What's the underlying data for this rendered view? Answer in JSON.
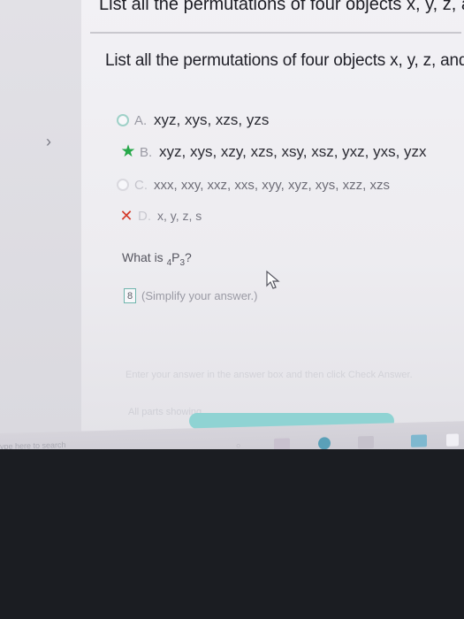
{
  "header": {
    "title": "List all the permutations of four objects x, y, z, and s taken"
  },
  "question": {
    "prompt": "List all the permutations of four objects x, y, z, and s taken"
  },
  "choices": [
    {
      "letter": "A.",
      "text": "xyz, xys, xzs, yzs",
      "marker": "radio"
    },
    {
      "letter": "B.",
      "text": "xyz, xys, xzy, xzs, xsy, xsz, yxz, yxs, yzx",
      "marker": "correct-star"
    },
    {
      "letter": "C.",
      "text": "xxx, xxy, xxz, xxs, xyy, xyz, xys, xzz, xzs",
      "marker": "radio"
    },
    {
      "letter": "D.",
      "text": "x, y, z, s",
      "marker": "incorrect-x"
    }
  ],
  "subquestion": {
    "text_before": "What is ",
    "sub": "4",
    "symbol": "P",
    "sup": "3",
    "text_after": "?"
  },
  "answer": {
    "value": "8",
    "hint": "(Simplify your answer.)"
  },
  "footer": {
    "instruction": "Enter your answer in the answer box and then click Check Answer.",
    "parts_label": "All parts showing"
  },
  "taskbar": {
    "search_placeholder": "ype here to search"
  },
  "colors": {
    "correct": "#27a84a",
    "incorrect": "#d43a2a",
    "accent": "#8fd3d3"
  }
}
